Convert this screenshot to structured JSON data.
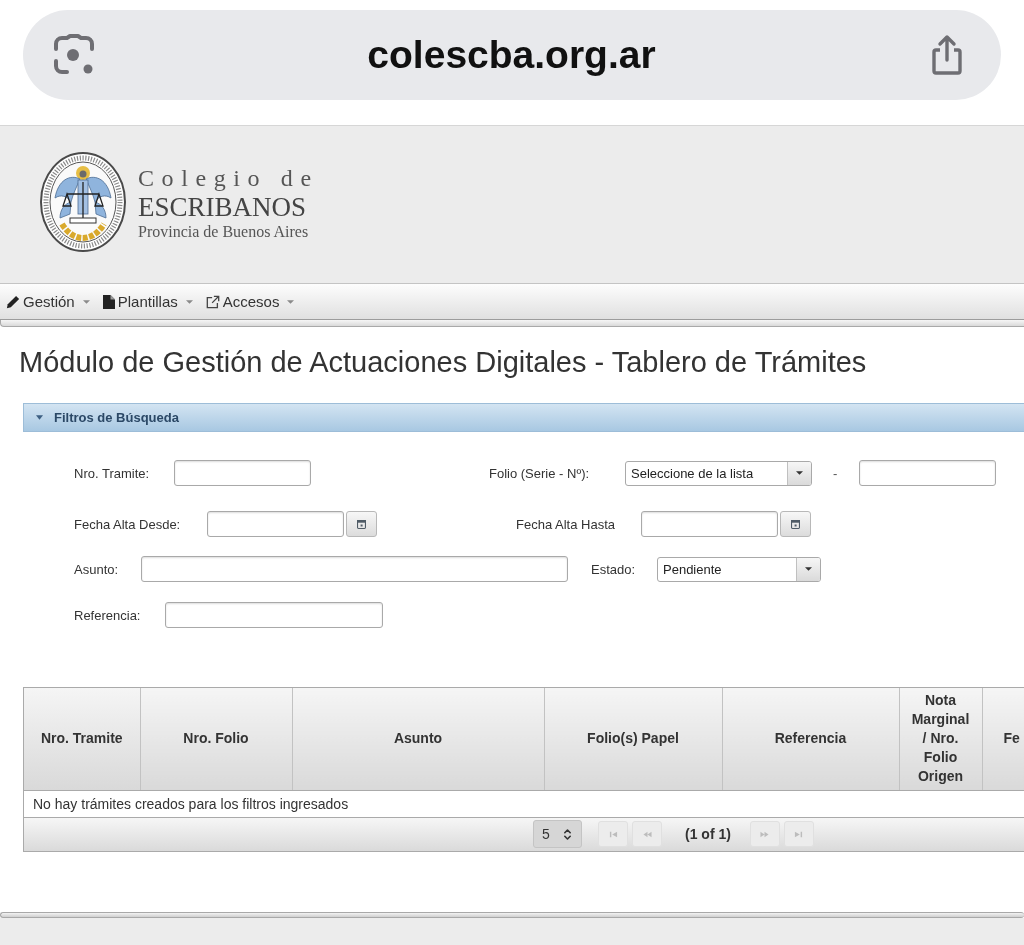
{
  "browser": {
    "url": "colescba.org.ar"
  },
  "brand": [
    {
      "kind": "spaced",
      "text": "Colegio de"
    },
    {
      "kind": "caps",
      "text": "ESCRIBANOS"
    },
    {
      "kind": "small",
      "text": "Provincia de Buenos Aires"
    }
  ],
  "menu": [
    {
      "label": "Gestión"
    },
    {
      "label": "Plantillas"
    },
    {
      "label": "Accesos"
    }
  ],
  "page_title": "Módulo de Gestión de Actuaciones Digitales - Tablero de Trámites",
  "filter_panel": {
    "title": "Filtros de Búsqueda",
    "expanded": true,
    "rows": [
      [
        {
          "kind": "text",
          "label": "Nro. Tramite:"
        },
        {
          "kind": "select_text",
          "label": "Folio (Serie - Nº):",
          "value": "Seleccione de la lista",
          "separator": "-"
        }
      ],
      [
        {
          "kind": "date",
          "label": "Fecha Alta Desde:"
        },
        {
          "kind": "date",
          "label": "Fecha Alta Hasta"
        }
      ],
      [
        {
          "kind": "text",
          "label": "Asunto:"
        },
        {
          "kind": "select",
          "label": "Estado:",
          "value": "Pendiente"
        }
      ],
      [
        {
          "kind": "text",
          "label": "Referencia:"
        }
      ]
    ]
  },
  "table": {
    "columns": [
      "Nro. Tramite",
      "Nro. Folio",
      "Asunto",
      "Folio(s) Papel",
      "Referencia",
      "Nota Marginal / Nro. Folio Origen",
      "Fe"
    ],
    "empty_message": "No hay trámites creados para los filtros ingresados"
  },
  "paginator": {
    "rows_per_page": "5",
    "page_report": "(1 of 1)",
    "buttons": [
      {
        "kind": "first",
        "disabled": true
      },
      {
        "kind": "previous",
        "disabled": true
      },
      {
        "kind": "next",
        "disabled": true
      },
      {
        "kind": "last",
        "disabled": true
      }
    ]
  }
}
